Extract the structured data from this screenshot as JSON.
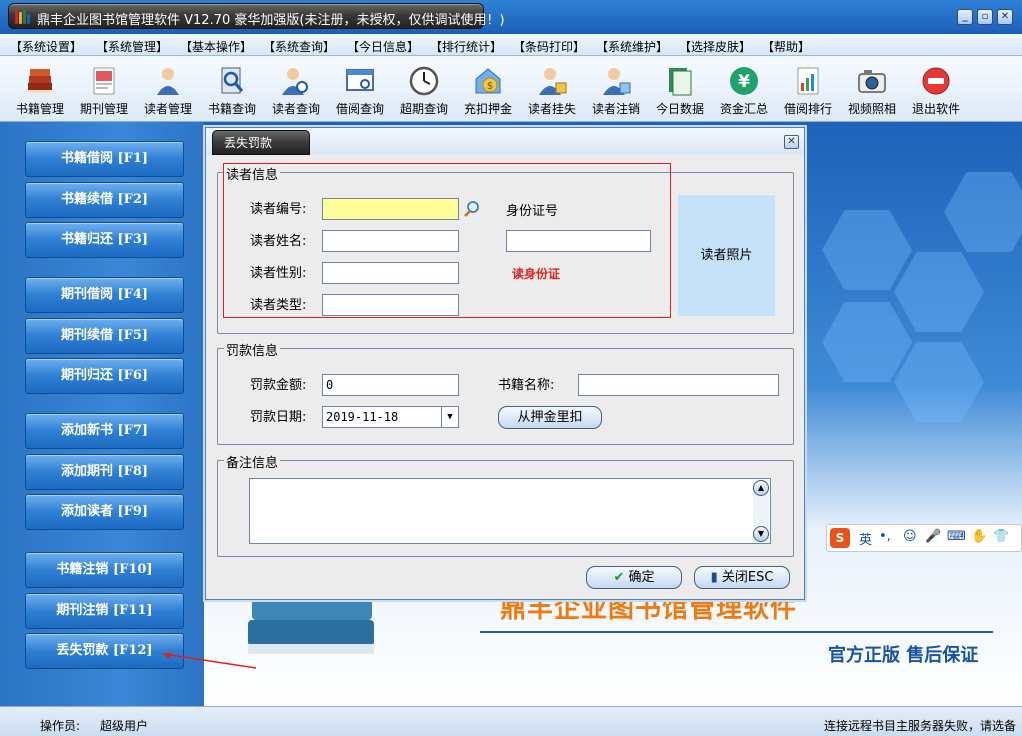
{
  "window": {
    "title": "鼎丰企业图书馆管理软件 V12.70 豪华加强版(未注册，未授权，仅供调试使用！)",
    "controls": [
      "minimize-icon",
      "restore-icon",
      "close-icon"
    ]
  },
  "menu": [
    "【系统设置】",
    "【系统管理】",
    "【基本操作】",
    "【系统查询】",
    "【今日信息】",
    "【排行统计】",
    "【条码打印】",
    "【系统维护】",
    "【选择皮肤】",
    "【帮助】"
  ],
  "toolbar": [
    {
      "label": "书籍管理",
      "icon": "books-icon"
    },
    {
      "label": "期刊管理",
      "icon": "magazine-icon"
    },
    {
      "label": "读者管理",
      "icon": "reader-icon"
    },
    {
      "label": "书籍查询",
      "icon": "book-search-icon"
    },
    {
      "label": "读者查询",
      "icon": "reader-search-icon"
    },
    {
      "label": "借阅查询",
      "icon": "borrow-search-icon"
    },
    {
      "label": "超期查询",
      "icon": "clock-icon"
    },
    {
      "label": "充扣押金",
      "icon": "deposit-icon"
    },
    {
      "label": "读者挂失",
      "icon": "reader-lost-icon"
    },
    {
      "label": "读者注销",
      "icon": "reader-cancel-icon"
    },
    {
      "label": "今日数据",
      "icon": "today-data-icon"
    },
    {
      "label": "资金汇总",
      "icon": "yen-icon"
    },
    {
      "label": "借阅排行",
      "icon": "ranking-icon"
    },
    {
      "label": "视频照相",
      "icon": "camera-icon"
    },
    {
      "label": "退出软件",
      "icon": "exit-icon"
    }
  ],
  "sidebar": [
    {
      "label": "书籍借阅 [F1]"
    },
    {
      "label": "书籍续借 [F2]"
    },
    {
      "label": "书籍归还 [F3]"
    },
    {
      "label": "期刊借阅 [F4]"
    },
    {
      "label": "期刊续借 [F5]"
    },
    {
      "label": "期刊归还 [F6]"
    },
    {
      "label": "添加新书 [F7]"
    },
    {
      "label": "添加期刊 [F8]"
    },
    {
      "label": "添加读者 [F9]"
    },
    {
      "label": "书籍注销 [F10]"
    },
    {
      "label": "期刊注销 [F11]"
    },
    {
      "label": "丢失罚款 [F12]"
    }
  ],
  "dialog": {
    "title": "丢失罚款",
    "reader_group": {
      "title": "读者信息",
      "id_label": "读者编号:",
      "id_value": "",
      "name_label": "读者姓名:",
      "name_value": "",
      "gender_label": "读者性别:",
      "gender_value": "",
      "type_label": "读者类型:",
      "type_value": "",
      "idcard_label": "身份证号",
      "idcard_value": "",
      "read_idcard_link": "读身份证",
      "photo_label": "读者照片"
    },
    "fine_group": {
      "title": "罚款信息",
      "amount_label": "罚款金额:",
      "amount_value": "0",
      "book_label": "书籍名称:",
      "book_value": "",
      "date_label": "罚款日期:",
      "date_value": "2019-11-18",
      "deduct_button": "从押金里扣"
    },
    "remark_group": {
      "title": "备注信息",
      "value": ""
    },
    "ok_button": "确定",
    "close_button": "关闭ESC"
  },
  "background": {
    "brand": "鼎丰企业图书馆管理软件",
    "slogan": "官方正版 售后保证"
  },
  "ime": {
    "label": "英"
  },
  "status": {
    "operator_label": "操作员:",
    "operator_value": "超级用户",
    "message": "连接远程书目主服务器失败，请选备"
  },
  "colors": {
    "accent": "#2f7fd3",
    "highlight_field": "#ffff99",
    "photo_box": "#c6e2f9",
    "annotation_red": "#e02020",
    "brand_orange": "#f07a10"
  }
}
